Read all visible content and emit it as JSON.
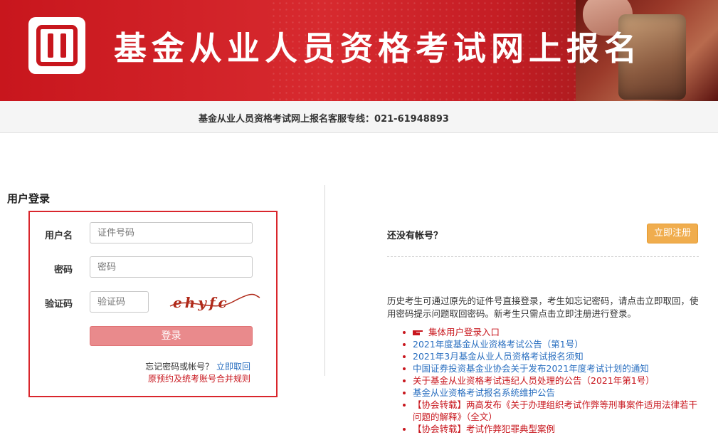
{
  "header": {
    "title": "基金从业人员资格考试网上报名",
    "hotline": "基金从业人员资格考试网上报名客服专线：021-61948893"
  },
  "login": {
    "section_title": "用户登录",
    "username_label": "用户名",
    "username_placeholder": "证件号码",
    "password_label": "密码",
    "password_placeholder": "密码",
    "captcha_label": "验证码",
    "captcha_placeholder": "验证码",
    "captcha_text": "ehyfc",
    "submit_label": "登录",
    "forgot_text": "忘记密码或帐号？",
    "forgot_link": "立即取回",
    "merge_rules_link": "原预约及统考账号合并规则"
  },
  "register": {
    "prompt": "还没有帐号？",
    "button_label": "立即注册",
    "intro": "历史考生可通过原先的证件号直接登录，考生如忘记密码，请点击立即取回，使用密码提示问题取回密码。新考生只需点击立即注册进行登录。"
  },
  "news": [
    {
      "text": "集体用户登录入口",
      "color": "red",
      "icon": "pointing-hand-icon"
    },
    {
      "text": "2021年度基金从业资格考试公告（第1号）",
      "color": "blue"
    },
    {
      "text": "2021年3月基金从业人员资格考试报名须知",
      "color": "blue"
    },
    {
      "text": "中国证券投资基金业协会关于发布2021年度考试计划的通知",
      "color": "blue"
    },
    {
      "text": "关于基金从业资格考试违纪人员处理的公告（2021年第1号）",
      "color": "red"
    },
    {
      "text": "基金从业资格考试报名系统维护公告",
      "color": "blue"
    },
    {
      "text": "【协会转载】两高发布《关于办理组织考试作弊等刑事案件适用法律若干问题的解释》（全文）",
      "color": "red"
    },
    {
      "text": "【协会转载】考试作弊犯罪典型案例",
      "color": "red"
    }
  ],
  "colors": {
    "brand_red": "#c8161d",
    "link_blue": "#2a6fc0",
    "register_orange": "#f0ad4e"
  }
}
